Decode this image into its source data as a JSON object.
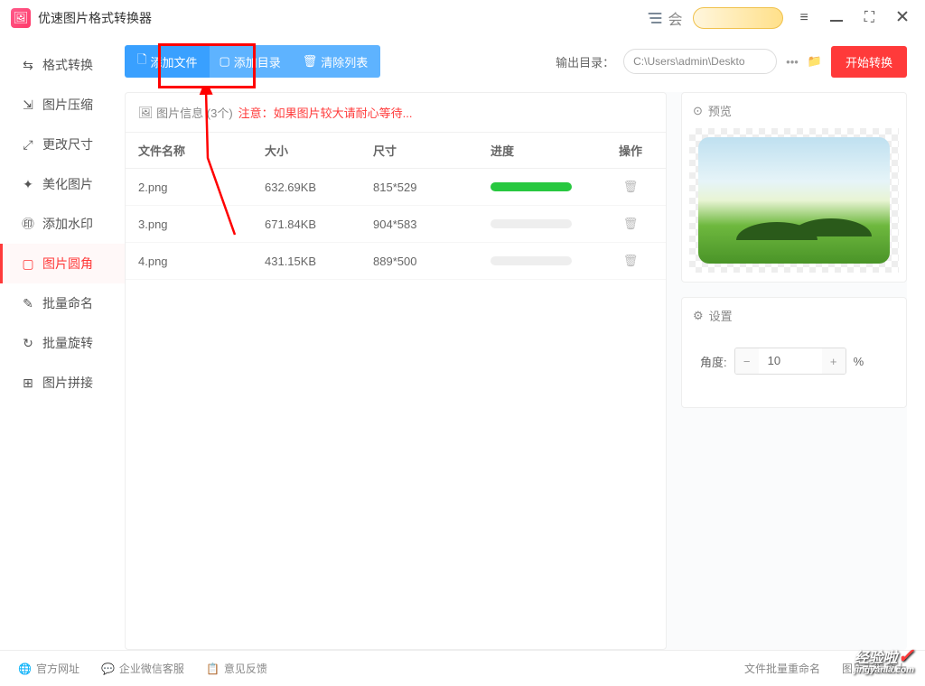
{
  "app": {
    "title": "优速图片格式转换器",
    "s_label": "会"
  },
  "sidebar": {
    "items": [
      {
        "label": "格式转换"
      },
      {
        "label": "图片压缩"
      },
      {
        "label": "更改尺寸"
      },
      {
        "label": "美化图片"
      },
      {
        "label": "添加水印"
      },
      {
        "label": "图片圆角"
      },
      {
        "label": "批量命名"
      },
      {
        "label": "批量旋转"
      },
      {
        "label": "图片拼接"
      }
    ]
  },
  "toolbar": {
    "add_file": "添加文件",
    "add_dir": "添加目录",
    "clear": "清除列表",
    "output_label": "输出目录：",
    "path": "C:\\Users\\admin\\Deskto",
    "start": "开始转换"
  },
  "panel": {
    "info_label": "图片信息",
    "count": "(3个)",
    "warn": "注意：如果图片较大请耐心等待...",
    "cols": {
      "name": "文件名称",
      "size": "大小",
      "dim": "尺寸",
      "prog": "进度",
      "op": "操作"
    },
    "rows": [
      {
        "name": "2.png",
        "size": "632.69KB",
        "dim": "815*529",
        "done": true
      },
      {
        "name": "3.png",
        "size": "671.84KB",
        "dim": "904*583",
        "done": false
      },
      {
        "name": "4.png",
        "size": "431.15KB",
        "dim": "889*500",
        "done": false
      }
    ]
  },
  "preview": {
    "label": "预览"
  },
  "settings": {
    "label": "设置",
    "angle_label": "角度:",
    "angle_value": "10",
    "percent": "%"
  },
  "footer": {
    "site": "官方网址",
    "wechat": "企业微信客服",
    "feedback": "意见反馈",
    "rename": "文件批量重命名",
    "lossless": "图片无损放大"
  },
  "watermark": {
    "main": "经验啦",
    "sub": "jingyanla.com"
  }
}
